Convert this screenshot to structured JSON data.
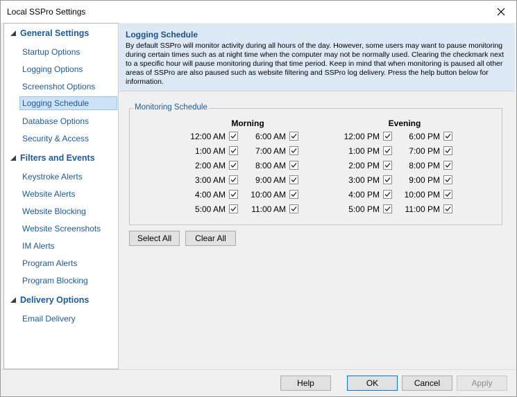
{
  "window": {
    "title": "Local SSPro Settings",
    "close_icon": "close-icon"
  },
  "sidebar": {
    "groups": [
      {
        "label": "General Settings",
        "items": [
          "Startup Options",
          "Logging Options",
          "Screenshot Options",
          "Logging Schedule",
          "Database Options",
          "Security & Access"
        ]
      },
      {
        "label": "Filters and Events",
        "items": [
          "Keystroke Alerts",
          "Website Alerts",
          "Website Blocking",
          "Website Screenshots",
          "IM Alerts",
          "Program Alerts",
          "Program Blocking"
        ]
      },
      {
        "label": "Delivery Options",
        "items": [
          "Email Delivery"
        ]
      }
    ],
    "selected": "Logging Schedule"
  },
  "info": {
    "title": "Logging Schedule",
    "text": "By default SSPro will monitor activity during all hours of the day. However, some users may want to pause monitoring during certain times such as at night time when the computer may not be normally used. Clearing the checkmark next to a specific hour will pause monitoring during that time period. Keep in mind that when monitoring is paused all other areas of SSPro are also paused such as website filtering and SSPro log delivery. Press the help button below for information."
  },
  "schedule": {
    "group_label": "Monitoring Schedule",
    "morning_label": "Morning",
    "evening_label": "Evening",
    "morning_col1": [
      "12:00 AM",
      "1:00 AM",
      "2:00 AM",
      "3:00 AM",
      "4:00 AM",
      "5:00 AM"
    ],
    "morning_col2": [
      "6:00 AM",
      "7:00 AM",
      "8:00 AM",
      "9:00 AM",
      "10:00 AM",
      "11:00 AM"
    ],
    "evening_col1": [
      "12:00 PM",
      "1:00 PM",
      "2:00 PM",
      "3:00 PM",
      "4:00 PM",
      "5:00 PM"
    ],
    "evening_col2": [
      "6:00 PM",
      "7:00 PM",
      "8:00 PM",
      "9:00 PM",
      "10:00 PM",
      "11:00 PM"
    ],
    "all_checked": true
  },
  "actions": {
    "select_all": "Select All",
    "clear_all": "Clear All"
  },
  "footer": {
    "help": "Help",
    "ok": "OK",
    "cancel": "Cancel",
    "apply": "Apply"
  },
  "colors": {
    "accent": "#1c5a9c",
    "info_bg": "#dde8f5",
    "selected_bg": "#cde2f7"
  }
}
